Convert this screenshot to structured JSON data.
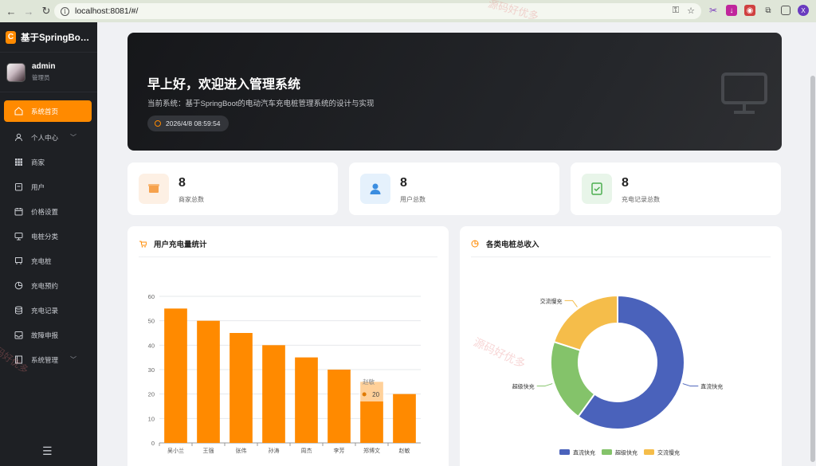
{
  "browser": {
    "url": "localhost:8081/#/",
    "profile_initial": "X"
  },
  "sidebar": {
    "brand_title": "基于SpringBoot...",
    "user_name": "admin",
    "user_role": "管理员",
    "items": [
      {
        "label": "系统首页",
        "icon": "home-icon",
        "active": true
      },
      {
        "label": "个人中心",
        "icon": "user-icon",
        "expandable": true
      },
      {
        "label": "商家",
        "icon": "grid-icon"
      },
      {
        "label": "用户",
        "icon": "clipboard-icon"
      },
      {
        "label": "价格设置",
        "icon": "calendar-icon"
      },
      {
        "label": "电桩分类",
        "icon": "monitor-icon"
      },
      {
        "label": "充电桩",
        "icon": "station-icon"
      },
      {
        "label": "充电预约",
        "icon": "pie-icon"
      },
      {
        "label": "充电记录",
        "icon": "database-icon"
      },
      {
        "label": "故障申报",
        "icon": "inbox-icon"
      },
      {
        "label": "系统管理",
        "icon": "film-icon",
        "expandable": true
      }
    ]
  },
  "hero": {
    "greeting": "早上好，欢迎进入管理系统",
    "subtitle": "当前系统：基于SpringBoot的电动汽车充电桩管理系统的设计与实现",
    "datetime": "2026/4/8 08:59:54"
  },
  "stats": [
    {
      "value": "8",
      "label": "商家总数",
      "color": "#f6a24d",
      "bg": "#fdf0e4",
      "icon": "store-icon"
    },
    {
      "value": "8",
      "label": "用户总数",
      "color": "#3b8de0",
      "bg": "#e5f1fc",
      "icon": "user-icon"
    },
    {
      "value": "8",
      "label": "充电记录总数",
      "color": "#4caf50",
      "bg": "#e8f5e9",
      "icon": "check-calendar-icon"
    }
  ],
  "bar_panel": {
    "title": "用户充电量统计",
    "tooltip_name": "赵敏",
    "tooltip_value": "20"
  },
  "pie_panel": {
    "title": "各类电桩总收入"
  },
  "watermark": "源码好优多",
  "colors": {
    "accent": "#ff8a00",
    "sidebar_bg": "#1e2024",
    "pie_blue": "#4a62bb",
    "pie_green": "#84c36a",
    "pie_yellow": "#f5bd4a"
  },
  "chart_data": [
    {
      "type": "bar",
      "categories": [
        "吴小兰",
        "王强",
        "张伟",
        "孙涛",
        "周杰",
        "李芳",
        "郑博文",
        "赵敏"
      ],
      "values": [
        55,
        50,
        45,
        40,
        35,
        30,
        25,
        20
      ],
      "ylim": [
        0,
        60
      ],
      "yticks": [
        0,
        10,
        20,
        30,
        40,
        50,
        60
      ],
      "color": "#ff8a00",
      "grid": true
    },
    {
      "type": "pie",
      "donut": true,
      "labels": [
        "直流快充",
        "超级快充",
        "交流慢充"
      ],
      "values": [
        60,
        20,
        20
      ],
      "colors": [
        "#4a62bb",
        "#84c36a",
        "#f5bd4a"
      ],
      "legend": "bottom"
    }
  ]
}
